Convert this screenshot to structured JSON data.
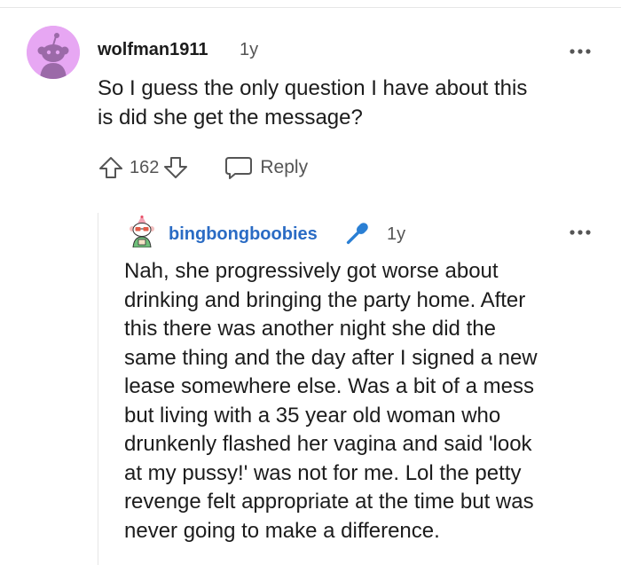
{
  "comment": {
    "username": "wolfman1911",
    "age": "1y",
    "lines": [
      "So I guess the only question I have about this",
      "is did she get the message?"
    ],
    "score": "162",
    "reply_label": "Reply",
    "avatar_color": "#e7a7f3"
  },
  "reply": {
    "username": "bingbongboobies",
    "username_color": "#2a6bc4",
    "flair_icon": "microphone-icon",
    "flair_color": "#2a7fd4",
    "age": "1y",
    "lines": [
      "Nah, she progressively got worse about",
      "drinking and bringing the party home. After",
      "this there was another night she did the",
      "same thing and the day after I signed a new",
      "lease somewhere else. Was a bit of a mess",
      "but living with a 35 year old woman who",
      "drunkenly flashed her vagina and said 'look",
      "at my pussy!' was not for me. Lol the petty",
      "revenge felt appropriate at the time but was",
      "never going to make a difference."
    ]
  },
  "icons": {
    "more": "more-options-icon",
    "upvote": "upvote-arrow-icon",
    "downvote": "downvote-arrow-icon",
    "reply": "reply-bubble-icon"
  }
}
